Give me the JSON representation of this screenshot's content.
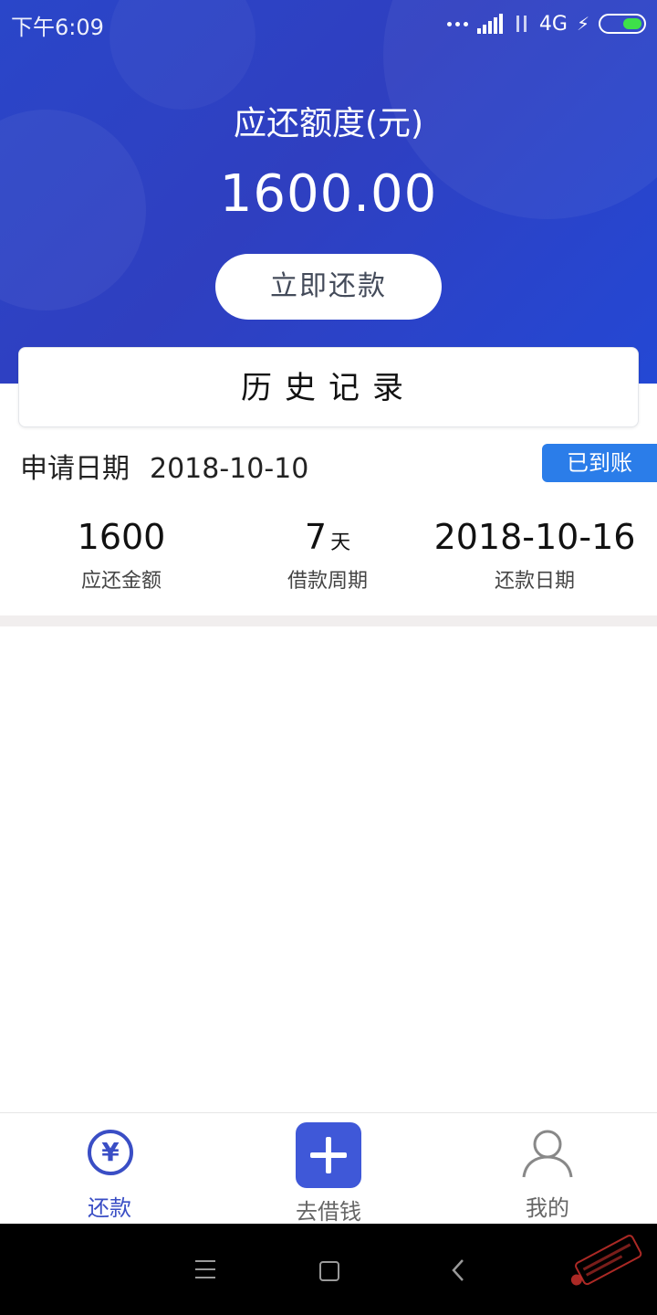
{
  "status_bar": {
    "time": "下午6:09",
    "network": "4G",
    "battery_color": "#3ee04a"
  },
  "header": {
    "title": "应还额度(元)",
    "amount": "1600.00",
    "repay_button": "立即还款"
  },
  "history": {
    "title": "历史记录"
  },
  "record": {
    "apply_label": "申请日期",
    "apply_date": "2018-10-10",
    "status_badge": "已到账",
    "stats": [
      {
        "value": "1600",
        "unit": "",
        "label": "应还金额"
      },
      {
        "value": "7",
        "unit": "天",
        "label": "借款周期"
      },
      {
        "value": "2018-10-16",
        "unit": "",
        "label": "还款日期"
      }
    ]
  },
  "tabbar": {
    "tabs": [
      {
        "label": "还款",
        "icon": "yen-circle-icon",
        "color": "#3a4ec5"
      },
      {
        "label": "去借钱",
        "icon": "plus-icon",
        "color": "#666666"
      },
      {
        "label": "我的",
        "icon": "user-icon",
        "color": "#666666"
      }
    ]
  },
  "colors": {
    "primary": "#2f3fc0",
    "badge": "#2b7de9"
  },
  "navigation_bar": {
    "icons": [
      "menu-icon",
      "home-icon",
      "back-icon"
    ]
  }
}
